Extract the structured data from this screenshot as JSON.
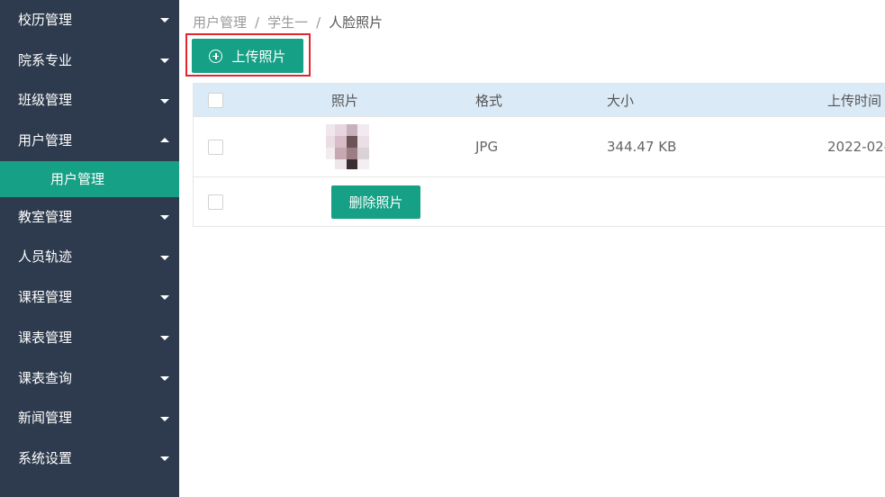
{
  "sidebar": {
    "items": [
      {
        "label": "校历管理",
        "expanded": false
      },
      {
        "label": "院系专业",
        "expanded": false
      },
      {
        "label": "班级管理",
        "expanded": false
      },
      {
        "label": "用户管理",
        "expanded": true,
        "children": [
          {
            "label": "用户管理",
            "active": true
          }
        ]
      },
      {
        "label": "教室管理",
        "expanded": false
      },
      {
        "label": "人员轨迹",
        "expanded": false
      },
      {
        "label": "课程管理",
        "expanded": false
      },
      {
        "label": "课表管理",
        "expanded": false
      },
      {
        "label": "课表查询",
        "expanded": false
      },
      {
        "label": "新闻管理",
        "expanded": false
      },
      {
        "label": "系统设置",
        "expanded": false
      }
    ]
  },
  "breadcrumb": {
    "items": [
      "用户管理",
      "学生一",
      "人脸照片"
    ],
    "separator": "/"
  },
  "toolbar": {
    "upload_label": "上传照片",
    "upload_icon": "plus-circle-icon"
  },
  "table": {
    "headers": {
      "photo": "照片",
      "format": "格式",
      "size": "大小",
      "upload_time": "上传时间"
    },
    "rows": [
      {
        "photo": "face-thumbnail",
        "format": "JPG",
        "size": "344.47 KB",
        "upload_time": "2022-02-"
      }
    ],
    "delete_label": "删除照片"
  },
  "colors": {
    "sidebar_bg": "#2e3b4e",
    "accent": "#16a085",
    "header_bg": "#dbeaf7",
    "highlight_border": "#e3262d"
  }
}
